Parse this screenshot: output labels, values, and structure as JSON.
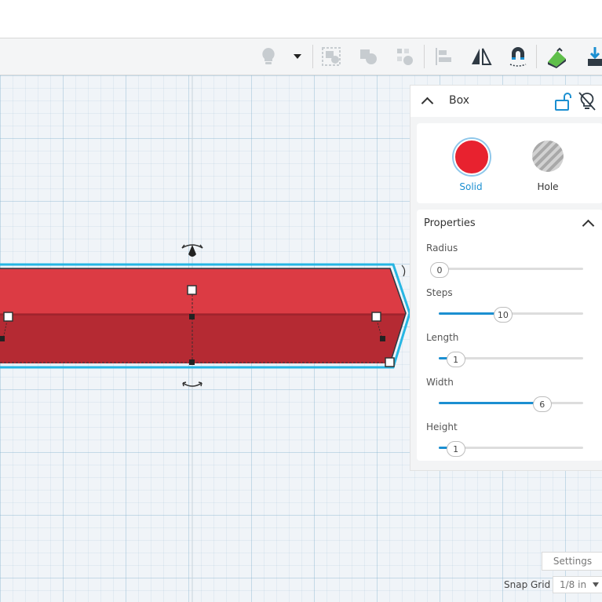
{
  "toolbar": {
    "buttons": [
      {
        "icon": "lightbulb-icon"
      },
      {
        "icon": "chevron-down-icon"
      },
      {
        "icon": "group-icon"
      },
      {
        "icon": "ungroup-icon"
      },
      {
        "icon": "duplicate-icon"
      },
      {
        "icon": "align-icon"
      },
      {
        "icon": "mirror-icon"
      },
      {
        "icon": "cruise-magnet-icon"
      },
      {
        "icon": "ruler-icon"
      },
      {
        "icon": "import-icon"
      }
    ]
  },
  "shape_panel": {
    "title": "Box",
    "solid_label": "Solid",
    "hole_label": "Hole",
    "solid_color": "#e8222f",
    "accent_color": "#1b8fd1"
  },
  "properties": {
    "title": "Properties",
    "params": [
      {
        "label": "Radius",
        "value": "0",
        "fraction": 0.0
      },
      {
        "label": "Steps",
        "value": "10",
        "fraction": 0.47
      },
      {
        "label": "Length",
        "value": "1",
        "fraction": 0.12
      },
      {
        "label": "Width",
        "value": "6",
        "fraction": 0.76
      },
      {
        "label": "Height",
        "value": "1",
        "fraction": 0.12
      }
    ]
  },
  "footer": {
    "settings_label": "Settings",
    "snap_grid_label": "Snap Grid",
    "snap_grid_value": "1/8 in"
  },
  "annotation": {
    "highlight_color": "#f5b21a"
  },
  "box_color": "#dc3b44"
}
